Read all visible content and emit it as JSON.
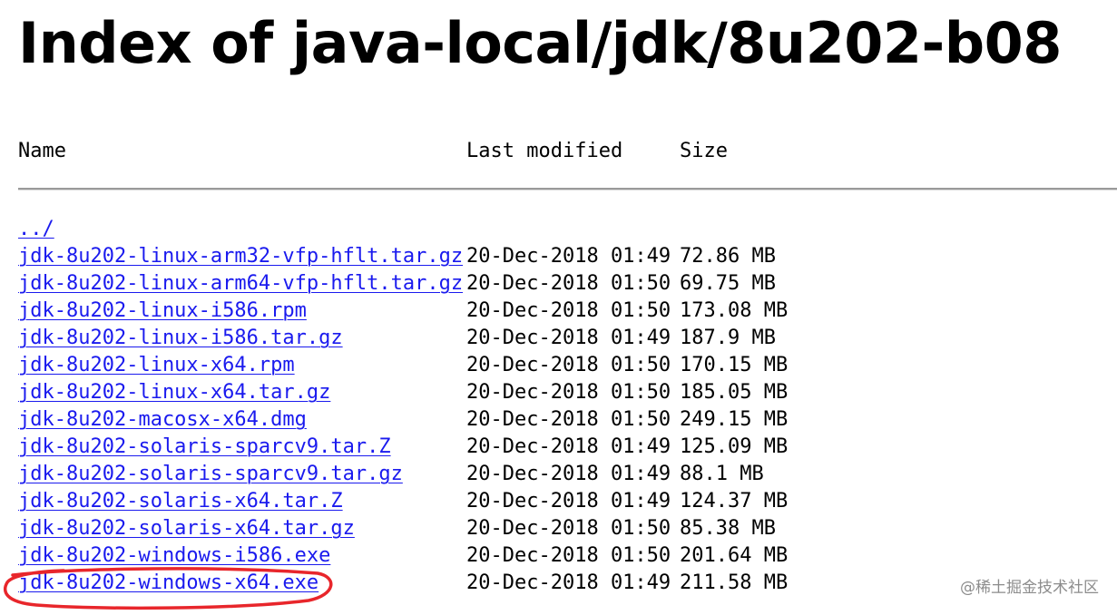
{
  "title": "Index of java-local/jdk/8u202-b08",
  "columns": {
    "name": "Name",
    "last_modified": "Last modified",
    "size": "Size"
  },
  "parent_link": "../",
  "entries": [
    {
      "name": "jdk-8u202-linux-arm32-vfp-hflt.tar.gz",
      "modified": "20-Dec-2018 01:49",
      "size": "72.86 MB"
    },
    {
      "name": "jdk-8u202-linux-arm64-vfp-hflt.tar.gz",
      "modified": "20-Dec-2018 01:50",
      "size": "69.75 MB"
    },
    {
      "name": "jdk-8u202-linux-i586.rpm",
      "modified": "20-Dec-2018 01:50",
      "size": "173.08 MB"
    },
    {
      "name": "jdk-8u202-linux-i586.tar.gz",
      "modified": "20-Dec-2018 01:49",
      "size": "187.9 MB"
    },
    {
      "name": "jdk-8u202-linux-x64.rpm",
      "modified": "20-Dec-2018 01:50",
      "size": "170.15 MB"
    },
    {
      "name": "jdk-8u202-linux-x64.tar.gz",
      "modified": "20-Dec-2018 01:50",
      "size": "185.05 MB"
    },
    {
      "name": "jdk-8u202-macosx-x64.dmg",
      "modified": "20-Dec-2018 01:50",
      "size": "249.15 MB"
    },
    {
      "name": "jdk-8u202-solaris-sparcv9.tar.Z",
      "modified": "20-Dec-2018 01:49",
      "size": "125.09 MB"
    },
    {
      "name": "jdk-8u202-solaris-sparcv9.tar.gz",
      "modified": "20-Dec-2018 01:49",
      "size": "88.1 MB"
    },
    {
      "name": "jdk-8u202-solaris-x64.tar.Z",
      "modified": "20-Dec-2018 01:49",
      "size": "124.37 MB"
    },
    {
      "name": "jdk-8u202-solaris-x64.tar.gz",
      "modified": "20-Dec-2018 01:50",
      "size": "85.38 MB"
    },
    {
      "name": "jdk-8u202-windows-i586.exe",
      "modified": "20-Dec-2018 01:50",
      "size": "201.64 MB"
    },
    {
      "name": "jdk-8u202-windows-x64.exe",
      "modified": "20-Dec-2018 01:49",
      "size": "211.58 MB"
    }
  ],
  "annotation": {
    "highlight_color": "#e8262b"
  },
  "watermark": "@稀土掘金技术社区",
  "colors": {
    "link": "#1a1aee",
    "rule": "#9a9a9a",
    "text": "#000000"
  }
}
